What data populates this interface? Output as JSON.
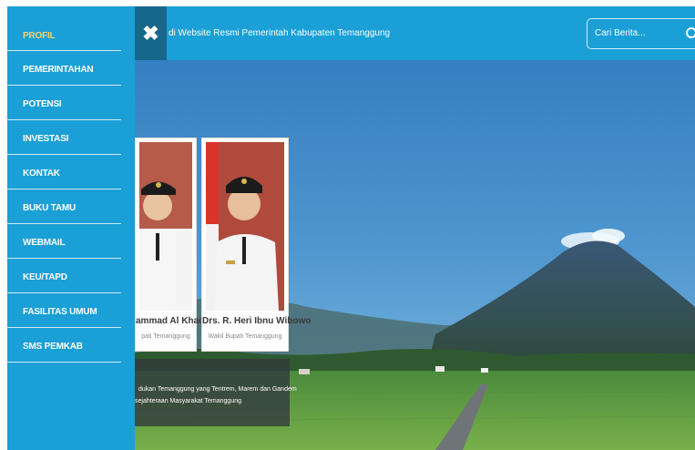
{
  "sidebar": {
    "items": [
      {
        "label": "PROFIL",
        "active": true
      },
      {
        "label": "PEMERINTAHAN",
        "active": false
      },
      {
        "label": "POTENSI",
        "active": false
      },
      {
        "label": "INVESTASI",
        "active": false
      },
      {
        "label": "KONTAK",
        "active": false
      },
      {
        "label": "BUKU TAMU",
        "active": false
      },
      {
        "label": "WEBMAIL",
        "active": false
      },
      {
        "label": "KEU/TAPD",
        "active": false
      },
      {
        "label": "FASILITAS UMUM",
        "active": false
      },
      {
        "label": "SMS PEMKAB",
        "active": false
      }
    ]
  },
  "header": {
    "close_icon": "close-icon",
    "marquee": "di Website Resmi Pemerintah Kabupaten Temanggung",
    "search": {
      "placeholder": "Cari Berita...",
      "icon": "search-icon"
    }
  },
  "officials": [
    {
      "name": "ammad Al Khadziq",
      "role": "pati Temanggung"
    },
    {
      "name": "Drs. R. Heri Ibnu Wibowo",
      "role": "Wakil Bupati Temanggung"
    }
  ],
  "visi": {
    "line1": "dukan Temanggung yang Tentrem, Marem dan Gandem",
    "line2": "sejahteraan Masyarakat Temanggung"
  },
  "colors": {
    "primary": "#1a9fd6",
    "active": "#f3d46a",
    "dark": "#16678a"
  }
}
